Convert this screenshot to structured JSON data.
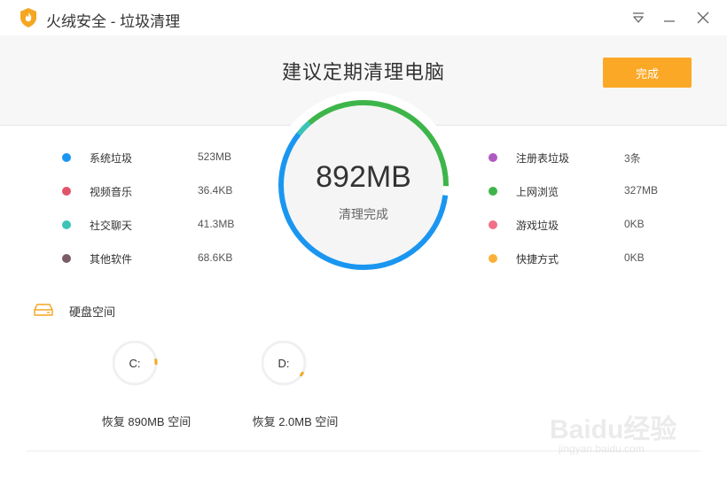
{
  "window": {
    "title": "火绒安全 - 垃圾清理",
    "brand_color": "#f5a623"
  },
  "banner": {
    "title": "建议定期清理电脑",
    "done_label": "完成",
    "done_color": "#fca827"
  },
  "summary": {
    "size": "892MB",
    "status": "清理完成",
    "ring_segments": [
      {
        "name": "系统垃圾",
        "fraction": 0.586,
        "color": "#1a96f0"
      },
      {
        "name": "社交聊天",
        "fraction": 0.03,
        "color": "#3cc3b8"
      },
      {
        "name": "上网浏览",
        "fraction": 0.366,
        "color": "#3db54a"
      }
    ]
  },
  "categories_left": [
    {
      "name": "系统垃圾",
      "size": "523MB",
      "color": "#1a96f0"
    },
    {
      "name": "视频音乐",
      "size": "36.4KB",
      "color": "#e0556a"
    },
    {
      "name": "社交聊天",
      "size": "41.3MB",
      "color": "#3cc3b8"
    },
    {
      "name": "其他软件",
      "size": "68.6KB",
      "color": "#7a5d66"
    }
  ],
  "categories_right": [
    {
      "name": "注册表垃圾",
      "size": "3条",
      "color": "#b159c2"
    },
    {
      "name": "上网浏览",
      "size": "327MB",
      "color": "#3db54a"
    },
    {
      "name": "游戏垃圾",
      "size": "0KB",
      "color": "#f07088"
    },
    {
      "name": "快捷方式",
      "size": "0KB",
      "color": "#fcb03b"
    }
  ],
  "disk": {
    "title": "硬盘空间",
    "icon": "hard-drive-icon",
    "drives": [
      {
        "letter": "C:",
        "caption": "恢复 890MB 空间"
      },
      {
        "letter": "D:",
        "caption": "恢复 2.0MB 空间"
      }
    ]
  },
  "watermark": {
    "text": "Baidu经验",
    "sub": "jingyan.baidu.com"
  }
}
